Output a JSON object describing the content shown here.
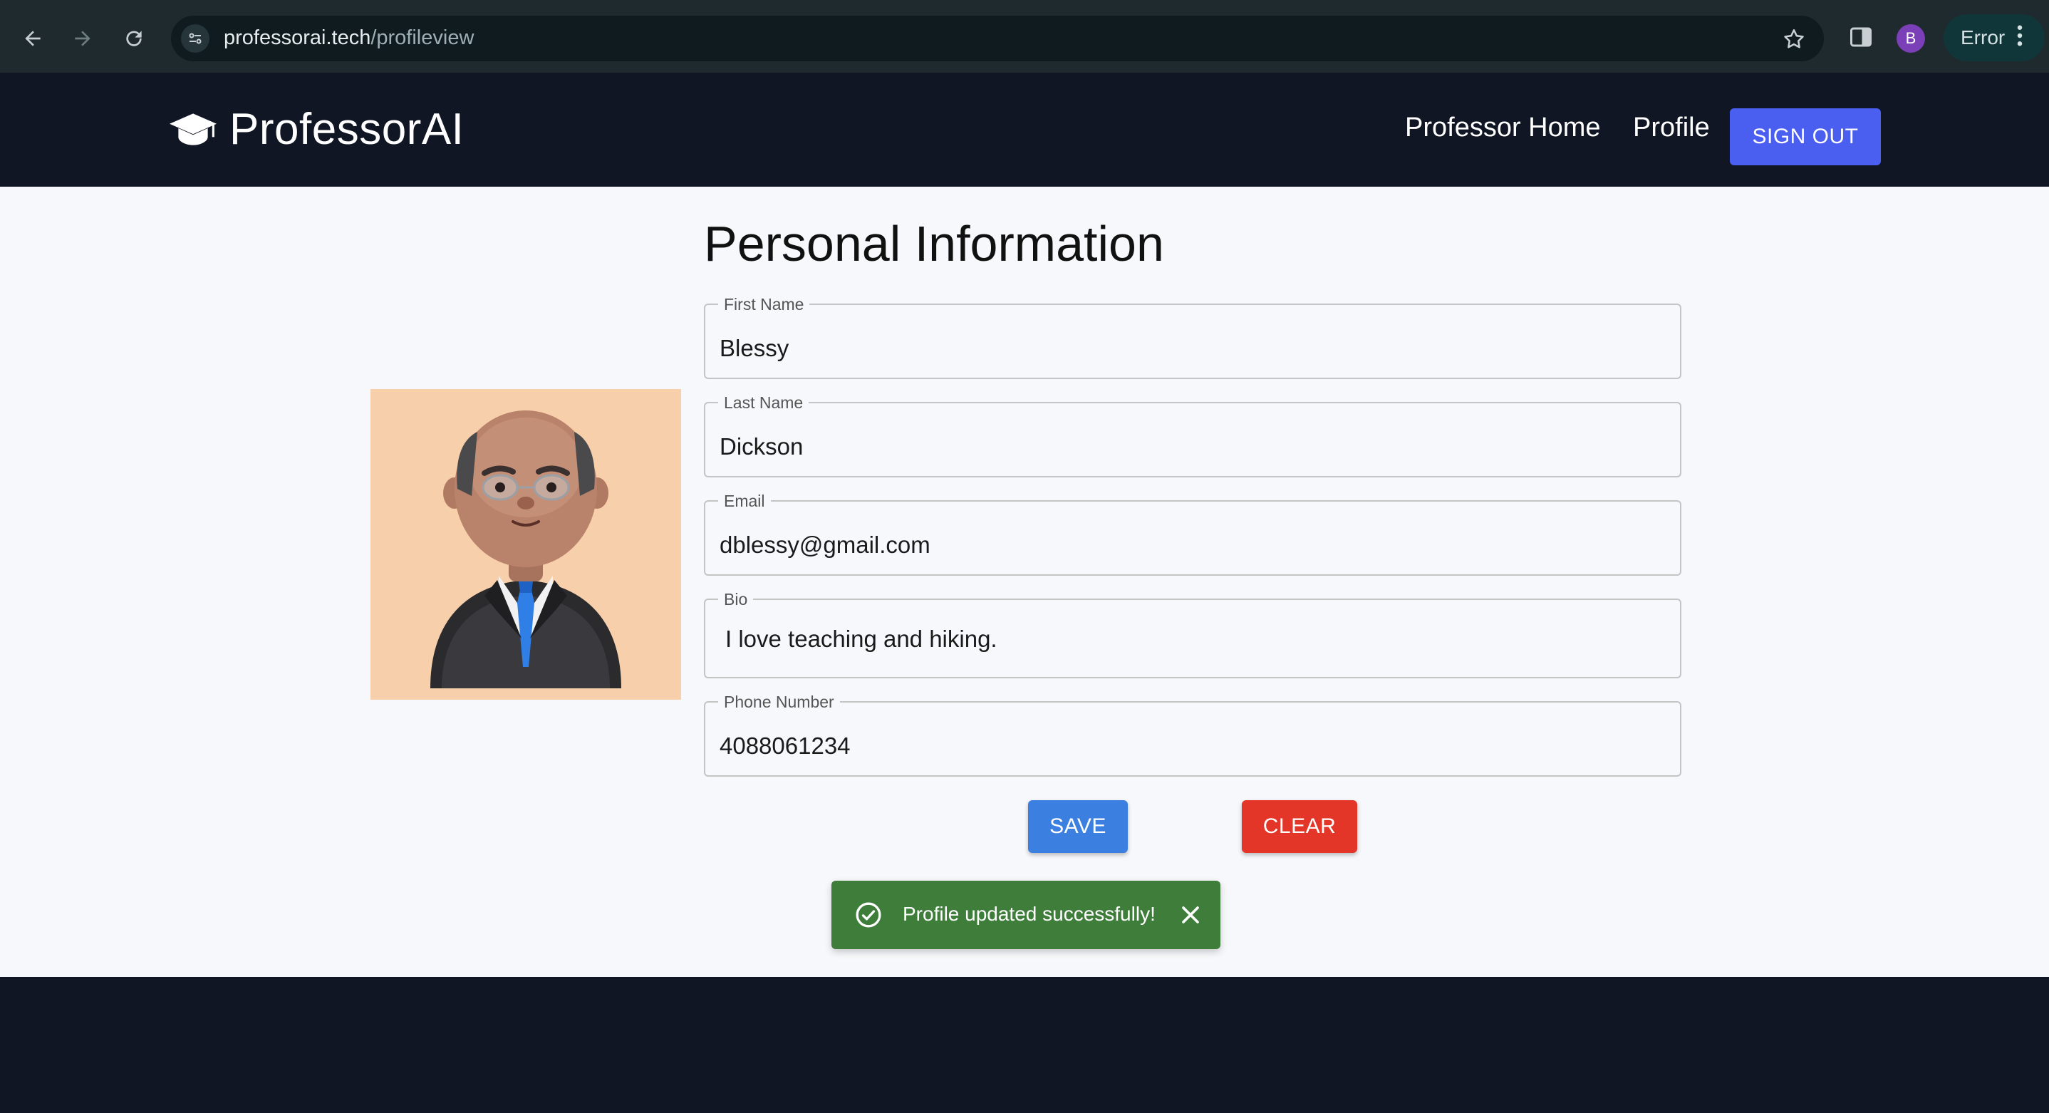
{
  "browser": {
    "url_host": "professorai.tech",
    "url_path": "/profileview",
    "profile_initial": "B",
    "status_chip": "Error"
  },
  "header": {
    "brand": "ProfessorAI",
    "nav": [
      "Professor Home",
      "Profile"
    ],
    "signout_label": "SIGN OUT"
  },
  "form": {
    "title": "Personal Information",
    "fields": [
      {
        "label": "First Name",
        "value": "Blessy"
      },
      {
        "label": "Last Name",
        "value": "Dickson"
      },
      {
        "label": "Email",
        "value": "dblessy@gmail.com"
      },
      {
        "label": "Bio",
        "value": "I love teaching and hiking."
      },
      {
        "label": "Phone Number",
        "value": "4088061234"
      }
    ],
    "save_label": "SAVE",
    "clear_label": "CLEAR"
  },
  "toast": {
    "message": "Profile updated successfully!"
  },
  "colors": {
    "header_bg": "#101624",
    "signout_bg": "#4a5ef0",
    "save_bg": "#3b7fe0",
    "clear_bg": "#e43628",
    "toast_bg": "#3f7d3b",
    "portrait_bg": "#f8cfab"
  },
  "icons": [
    "back-arrow-icon",
    "forward-arrow-icon",
    "reload-icon",
    "site-settings-icon",
    "bookmark-star-icon",
    "side-panel-icon",
    "more-vert-icon",
    "graduation-cap-icon",
    "check-circle-icon",
    "close-icon"
  ]
}
